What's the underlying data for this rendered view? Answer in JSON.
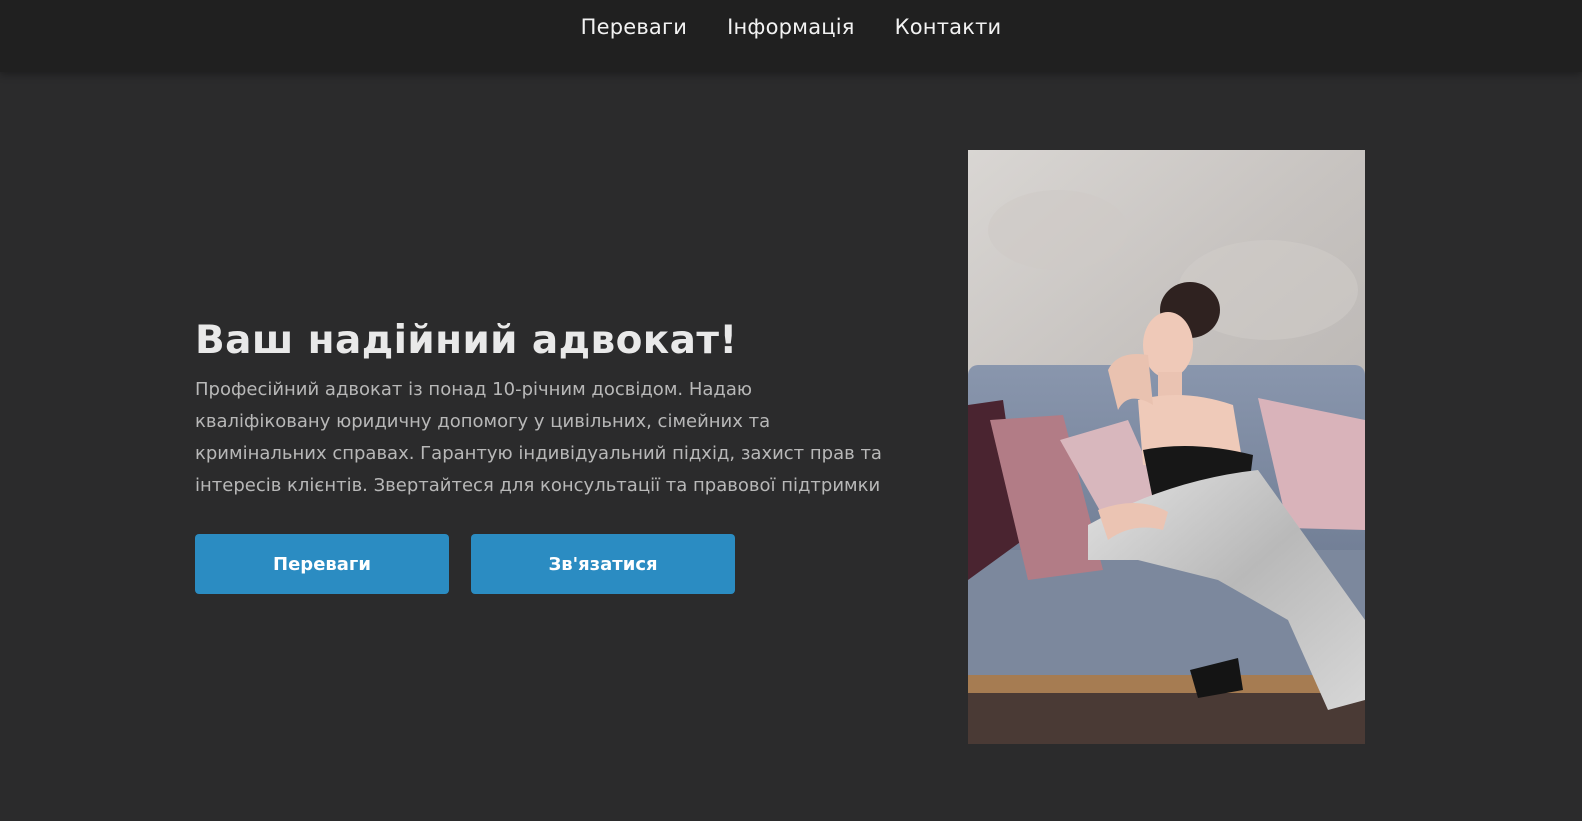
{
  "nav": {
    "items": [
      {
        "label": "Переваги"
      },
      {
        "label": "Інформація"
      },
      {
        "label": "Контакти"
      }
    ]
  },
  "hero": {
    "title": "Ваш надійний адвокат!",
    "description": "Професійний адвокат із понад 10-річним досвідом. Надаю кваліфіковану юридичну допомогу у цивільних, сімейних та кримінальних справах. Гарантую індивідуальний підхід, захист прав та інтересів клієнтів. Звертайтеся для консультації та правової підтримки",
    "buttons": {
      "advantages_label": "Переваги",
      "contact_label": "Зв'язатися"
    }
  },
  "colors": {
    "page_background": "#2b2b2c",
    "nav_background": "#202020",
    "accent": "#2b8cc2",
    "title_text": "#e9e9e9",
    "body_text": "#b8b8b8"
  }
}
